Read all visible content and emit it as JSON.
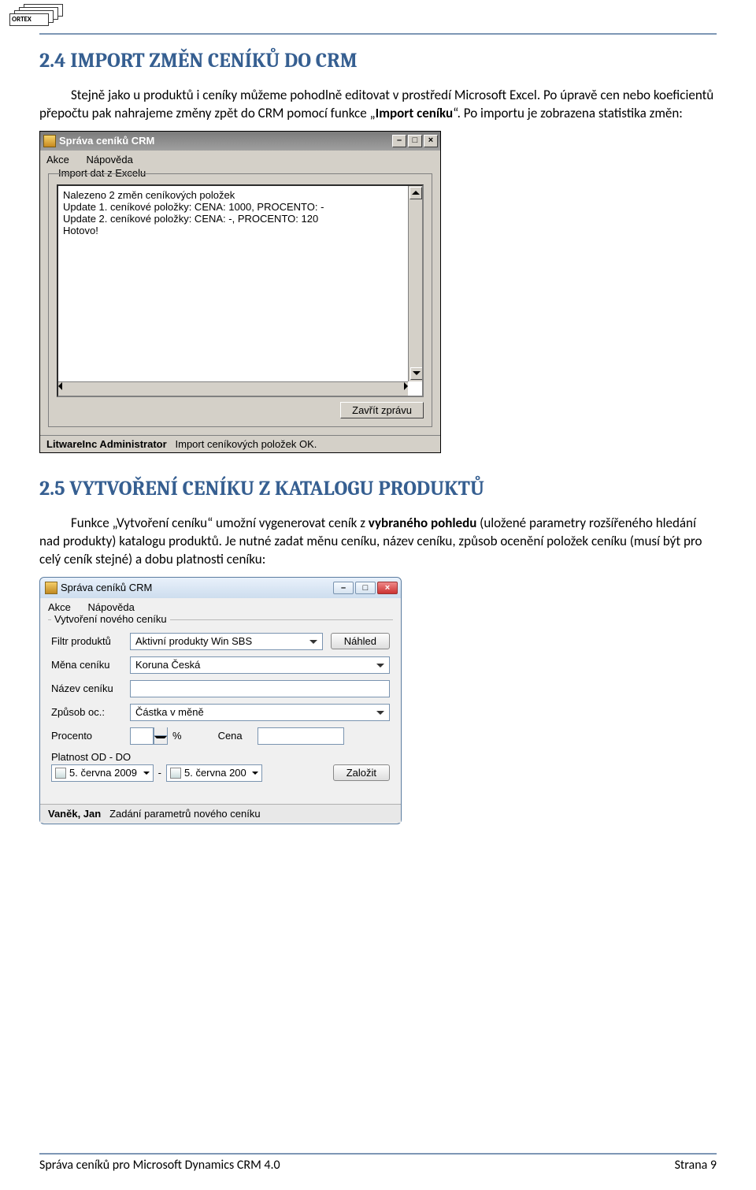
{
  "logo": "ORTEX",
  "section1": {
    "heading": "2.4 IMPORT ZMĚN CENÍKŮ DO CRM",
    "p1a": "Stejně jako u produktů i ceníky můžeme pohodlně editovat v prostředí Microsoft Excel. Po úpravě cen nebo koeficientů přepočtu pak nahrajeme změny zpět do CRM pomocí funkce „",
    "p1b": "Import ceníku",
    "p1c": "“. Po importu je zobrazena statistika změn:"
  },
  "screenshot1": {
    "title": "Správa ceníků CRM",
    "menu": [
      "Akce",
      "Nápověda"
    ],
    "groupLabel": "Import dat z Excelu",
    "log": [
      "Nalezeno 2 změn ceníkových položek",
      "Update 1. ceníkové položky: CENA: 1000, PROCENTO: -",
      "Update 2. ceníkové položky: CENA: -, PROCENTO: 120",
      "Hotovo!"
    ],
    "closeBtn": "Zavřít zprávu",
    "statusUser": "LitwareInc Administrator",
    "statusMsg": "Import ceníkových položek OK."
  },
  "section2": {
    "heading": "2.5 VYTVOŘENÍ CENÍKU Z KATALOGU PRODUKTŮ",
    "p1a": "Funkce „Vytvoření ceníku“ umožní vygenerovat ceník z ",
    "p1b": "vybraného pohledu",
    "p1c": " (uložené parametry rozšířeného hledání nad produkty) katalogu produktů. Je nutné zadat měnu ceníku, název ceníku, způsob ocenění položek ceníku (musí být pro celý ceník stejné) a dobu platnosti ceníku:"
  },
  "screenshot2": {
    "title": "Správa ceníků CRM",
    "menu": [
      "Akce",
      "Nápověda"
    ],
    "groupLabel": "Vytvoření nového ceníku",
    "filterLabel": "Filtr produktů",
    "filterValue": "Aktivní produkty Win SBS",
    "previewBtn": "Náhled",
    "currencyLabel": "Měna ceníku",
    "currencyValue": "Koruna Česká",
    "nameLabel": "Název ceníku",
    "nameValue": "",
    "methodLabel": "Způsob oc.:",
    "methodValue": "Částka v měně",
    "percentLabel": "Procento",
    "percentSuffix": "%",
    "priceLabel": "Cena",
    "priceValue": "",
    "validLabel": "Platnost OD - DO",
    "dateFrom": "5. června 2009",
    "dateTo": "5. června 200",
    "sep": "-",
    "createBtn": "Založit",
    "statusUser": "Vaněk, Jan",
    "statusMsg": "Zadání parametrů nového ceníku"
  },
  "footer": {
    "left": "Správa ceníků pro Microsoft Dynamics CRM 4.0",
    "right": "Strana 9"
  }
}
